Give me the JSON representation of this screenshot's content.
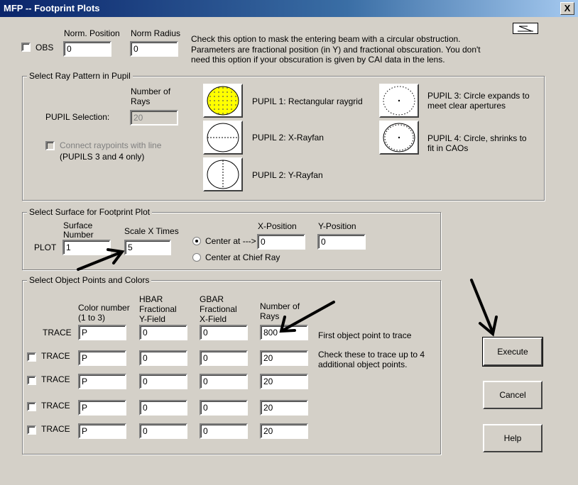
{
  "window": {
    "title": "MFP -- Footprint Plots",
    "close": "X"
  },
  "obs": {
    "label": "OBS",
    "norm_position_label": "Norm. Position",
    "norm_radius_label": "Norm Radius",
    "norm_position_value": "0",
    "norm_radius_value": "0",
    "help_lines": [
      "Check this option to mask the entering beam with a circular obstruction.",
      "Parameters are fractional position (in Y) and fractional obscuration. You don't",
      "need this option if your obscuration is given by CAI data in the lens."
    ]
  },
  "ray_pattern": {
    "title": "Select Ray Pattern in Pupil",
    "num_rays_label_1": "Number of",
    "num_rays_label_2": "Rays",
    "pupil_selection_label": "PUPIL Selection:",
    "num_rays_value": "20",
    "connect_label": "Connect raypoints with line",
    "connect_note": "(PUPILS 3 and 4 only)",
    "pupil1_label": "PUPIL 1: Rectangular raygrid",
    "pupil2x_label": "PUPIL 2: X-Rayfan",
    "pupil2y_label": "PUPIL 2: Y-Rayfan",
    "pupil3_label_1": "PUPIL 3: Circle expands to",
    "pupil3_label_2": "meet clear apertures",
    "pupil4_label_1": "PUPIL 4: Circle, shrinks to",
    "pupil4_label_2": "fit in CAOs",
    "selected_fill": "#ffff00"
  },
  "surface": {
    "title": "Select Surface for Footprint Plot",
    "surface_number_label_1": "Surface",
    "surface_number_label_2": "Number",
    "scale_label": "Scale X Times",
    "plot_label": "PLOT",
    "surface_value": "1",
    "scale_value": "5",
    "center_at_label": "Center at --->",
    "center_chief_label": "Center at Chief Ray",
    "x_pos_label": "X-Position",
    "y_pos_label": "Y-Position",
    "x_pos_value": "0",
    "y_pos_value": "0"
  },
  "objects": {
    "title": "Select Object Points and Colors",
    "col_color_1": "Color number",
    "col_color_2": "(1 to 3)",
    "col_hbar_1": "HBAR",
    "col_hbar_2": "Fractional",
    "col_hbar_3": "Y-Field",
    "col_gbar_1": "GBAR",
    "col_gbar_2": "Fractional",
    "col_gbar_3": "X-Field",
    "col_rays_1": "Number of",
    "col_rays_2": "Rays",
    "trace_label": "TRACE",
    "first_note": "First object point to trace",
    "check_note_1": "Check these to trace up to 4",
    "check_note_2": "additional object points.",
    "rows": [
      {
        "color": "P",
        "hbar": "0",
        "gbar": "0",
        "rays": "800"
      },
      {
        "color": "P",
        "hbar": "0",
        "gbar": "0",
        "rays": "20"
      },
      {
        "color": "P",
        "hbar": "0",
        "gbar": "0",
        "rays": "20"
      },
      {
        "color": "P",
        "hbar": "0",
        "gbar": "0",
        "rays": "20"
      },
      {
        "color": "P",
        "hbar": "0",
        "gbar": "0",
        "rays": "20"
      }
    ]
  },
  "buttons": {
    "execute": "Execute",
    "cancel": "Cancel",
    "help": "Help"
  }
}
